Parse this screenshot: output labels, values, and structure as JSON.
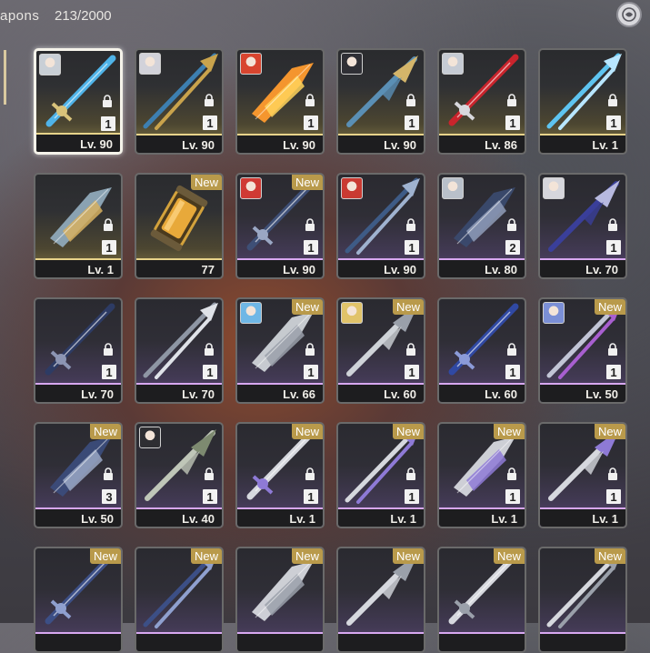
{
  "header": {
    "title": "apons",
    "count": "213/2000",
    "sort_icon": "sort-icon"
  },
  "colors": {
    "gold_accent": "#e7d38a",
    "purple_accent": "#d7a7f0",
    "new_badge": "#b99a4b"
  },
  "weapons": [
    {
      "level": "Lv. 90",
      "qty": "1",
      "rarity": "gold",
      "avatar": "#c9cfd6",
      "new": "",
      "selected": true,
      "blade": "#4fb3e8",
      "accent": "#d8c27a"
    },
    {
      "level": "Lv. 90",
      "qty": "1",
      "rarity": "gold",
      "avatar": "#d2d2da",
      "new": "",
      "selected": false,
      "blade": "#3d7fb0",
      "accent": "#c9a34c"
    },
    {
      "level": "Lv. 90",
      "qty": "1",
      "rarity": "gold",
      "avatar": "#d8452f",
      "new": "",
      "selected": false,
      "blade": "#ff9b2e",
      "accent": "#ffd35a"
    },
    {
      "level": "Lv. 90",
      "qty": "1",
      "rarity": "gold",
      "avatar": "#2f2f35",
      "new": "",
      "selected": false,
      "blade": "#5a8fb5",
      "accent": "#d4b56a"
    },
    {
      "level": "Lv. 86",
      "qty": "1",
      "rarity": "gold",
      "avatar": "#c6cbd4",
      "new": "",
      "selected": false,
      "blade": "#c9242c",
      "accent": "#d8d8dd"
    },
    {
      "level": "Lv. 1",
      "qty": "1",
      "rarity": "gold",
      "avatar": "",
      "new": "",
      "selected": false,
      "blade": "#5ec4f0",
      "accent": "#b8e6ff"
    },
    {
      "level": "Lv. 1",
      "qty": "1",
      "rarity": "gold",
      "avatar": "",
      "new": "",
      "selected": false,
      "blade": "#8fa9b9",
      "accent": "#d6b060"
    },
    {
      "level": "77",
      "qty": "",
      "rarity": "gold",
      "avatar": "",
      "new": "New",
      "selected": false,
      "blade": "capsule",
      "accent": "#e2a834"
    },
    {
      "level": "Lv. 90",
      "qty": "1",
      "rarity": "purple",
      "avatar": "#cf3a34",
      "new": "New",
      "selected": false,
      "blade": "#3e4f76",
      "accent": "#9aa7c4"
    },
    {
      "level": "Lv. 90",
      "qty": "1",
      "rarity": "purple",
      "avatar": "#c93a32",
      "new": "",
      "selected": false,
      "blade": "#3e5b86",
      "accent": "#9fb2cf"
    },
    {
      "level": "Lv. 80",
      "qty": "2",
      "rarity": "purple",
      "avatar": "#b9c0ca",
      "new": "",
      "selected": false,
      "blade": "#3a4a6e",
      "accent": "#8f9cb8"
    },
    {
      "level": "Lv. 70",
      "qty": "1",
      "rarity": "purple",
      "avatar": "#d6d6dc",
      "new": "",
      "selected": false,
      "blade": "#3a3f9a",
      "accent": "#b7b9df"
    },
    {
      "level": "Lv. 70",
      "qty": "1",
      "rarity": "purple",
      "avatar": "",
      "new": "",
      "selected": false,
      "blade": "#2d3b64",
      "accent": "#8c95b3"
    },
    {
      "level": "Lv. 70",
      "qty": "1",
      "rarity": "purple",
      "avatar": "",
      "new": "",
      "selected": false,
      "blade": "#8e96a4",
      "accent": "#dfe2e8"
    },
    {
      "level": "Lv. 66",
      "qty": "1",
      "rarity": "purple",
      "avatar": "#6fb7e6",
      "new": "New",
      "selected": false,
      "blade": "#cfd3d8",
      "accent": "#9aa0aa"
    },
    {
      "level": "Lv. 60",
      "qty": "1",
      "rarity": "purple",
      "avatar": "#e1c36a",
      "new": "New",
      "selected": false,
      "blade": "#cfd3d8",
      "accent": "#9aa0aa"
    },
    {
      "level": "Lv. 60",
      "qty": "1",
      "rarity": "purple",
      "avatar": "",
      "new": "",
      "selected": false,
      "blade": "#3049a3",
      "accent": "#8b9bd8"
    },
    {
      "level": "Lv. 50",
      "qty": "1",
      "rarity": "purple",
      "avatar": "#7b8fd6",
      "new": "New",
      "selected": false,
      "blade": "#c2c5d6",
      "accent": "#a85fd0"
    },
    {
      "level": "Lv. 50",
      "qty": "3",
      "rarity": "purple",
      "avatar": "",
      "new": "New",
      "selected": false,
      "blade": "#3b4c7a",
      "accent": "#9aa7c4"
    },
    {
      "level": "Lv. 40",
      "qty": "1",
      "rarity": "purple",
      "avatar": "#2e2e32",
      "new": "",
      "selected": false,
      "blade": "#bfc6b8",
      "accent": "#7d8a70"
    },
    {
      "level": "Lv. 1",
      "qty": "1",
      "rarity": "purple",
      "avatar": "",
      "new": "New",
      "selected": false,
      "blade": "#d6d8de",
      "accent": "#8e7ad6"
    },
    {
      "level": "Lv. 1",
      "qty": "1",
      "rarity": "purple",
      "avatar": "",
      "new": "New",
      "selected": false,
      "blade": "#d6d8de",
      "accent": "#8e7ad6"
    },
    {
      "level": "Lv. 1",
      "qty": "1",
      "rarity": "purple",
      "avatar": "",
      "new": "New",
      "selected": false,
      "blade": "#d6d8de",
      "accent": "#8e7ad6"
    },
    {
      "level": "Lv. 1",
      "qty": "1",
      "rarity": "purple",
      "avatar": "",
      "new": "New",
      "selected": false,
      "blade": "#d6d8de",
      "accent": "#8e7ad6"
    },
    {
      "level": "",
      "qty": "",
      "rarity": "purple",
      "avatar": "",
      "new": "New",
      "selected": false,
      "blade": "#3c4f86",
      "accent": "#8fa0cf"
    },
    {
      "level": "",
      "qty": "",
      "rarity": "purple",
      "avatar": "",
      "new": "New",
      "selected": false,
      "blade": "#3c4f86",
      "accent": "#8fa0cf"
    },
    {
      "level": "",
      "qty": "",
      "rarity": "purple",
      "avatar": "",
      "new": "New",
      "selected": false,
      "blade": "#d6d8de",
      "accent": "#9aa0aa"
    },
    {
      "level": "",
      "qty": "",
      "rarity": "purple",
      "avatar": "",
      "new": "New",
      "selected": false,
      "blade": "#d6d8de",
      "accent": "#9aa0aa"
    },
    {
      "level": "",
      "qty": "",
      "rarity": "purple",
      "avatar": "",
      "new": "New",
      "selected": false,
      "blade": "#d6d8de",
      "accent": "#9aa0aa"
    },
    {
      "level": "",
      "qty": "",
      "rarity": "purple",
      "avatar": "",
      "new": "New",
      "selected": false,
      "blade": "#d6d8de",
      "accent": "#9aa0aa"
    }
  ]
}
